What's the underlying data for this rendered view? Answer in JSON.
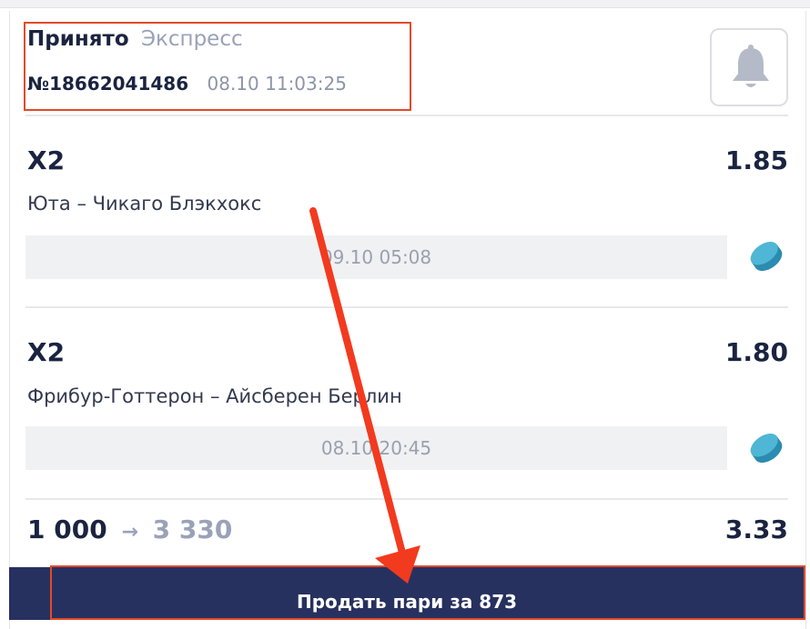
{
  "ticket": {
    "status": "Принято",
    "type": "Экспресс",
    "bet_id": "№18662041486",
    "placed_at": "08.10 11:03:25"
  },
  "bell_button": {
    "icon": "bell-icon"
  },
  "selections": [
    {
      "outcome": "X2",
      "odds": "1.85",
      "event": "Юта – Чикаго Блэкхокс",
      "date": "09.10 05:08",
      "sport_icon": "hockey-puck-icon"
    },
    {
      "outcome": "X2",
      "odds": "1.80",
      "event": "Фрибур-Готтерон – Айсберен Берлин",
      "date": "08.10 20:45",
      "sport_icon": "hockey-puck-icon"
    }
  ],
  "summary": {
    "stake": "1 000",
    "arrow": "→",
    "payout": "3 330",
    "total_odds": "3.33"
  },
  "sell_button": {
    "label": "Продать пари за 873"
  },
  "colors": {
    "primary_dark": "#27315f",
    "muted_text": "#9aa2b8",
    "annotation_red": "#e24a2a",
    "puck_blue": "#3aa3c6"
  }
}
